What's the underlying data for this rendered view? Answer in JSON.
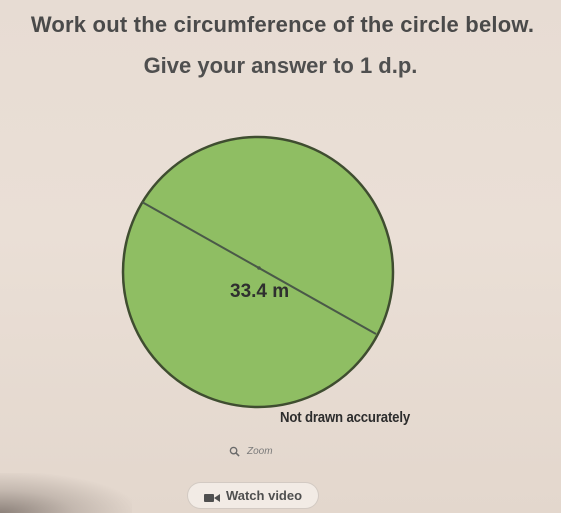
{
  "question": {
    "line1": "Work out the circumference of the circle below.",
    "line2": "Give your answer to 1 d.p."
  },
  "diagram": {
    "diameter_label": "33.4 m",
    "note": "Not drawn accurately",
    "circle_fill": "#8fbe63",
    "circle_stroke": "#3f4d30"
  },
  "controls": {
    "zoom_label": "Zoom",
    "watch_video_label": "Watch video"
  },
  "icons": {
    "zoom": "search-icon",
    "video": "video-icon"
  }
}
